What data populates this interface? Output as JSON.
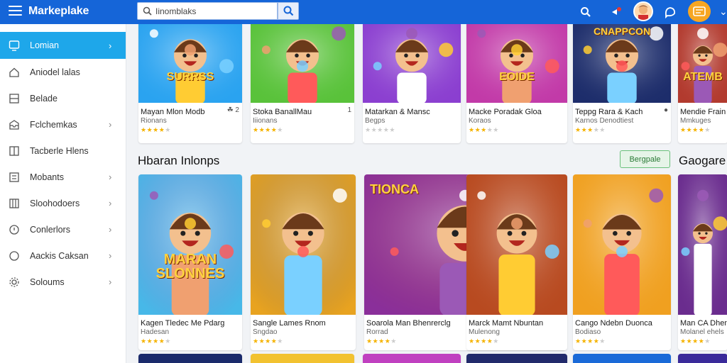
{
  "header": {
    "title": "Markeplake",
    "search": {
      "value": "Iinomblaks",
      "placeholder": "Search"
    },
    "icons": [
      "menu-icon",
      "search-icon",
      "notification-icon",
      "profile-avatar",
      "chat-icon",
      "wallet-icon"
    ]
  },
  "sidebar": {
    "items": [
      {
        "label": "Lomian",
        "icon": "monitor-icon",
        "active": true,
        "arrow": true
      },
      {
        "label": "Aniodel lalas",
        "icon": "home-icon",
        "arrow": false
      },
      {
        "label": "Belade",
        "icon": "grid-icon",
        "arrow": false
      },
      {
        "label": "Fclchemkas",
        "icon": "inbox-icon",
        "arrow": true
      },
      {
        "label": "Tacberle Hlens",
        "icon": "book-icon",
        "arrow": false
      },
      {
        "label": "Mobants",
        "icon": "list-icon",
        "arrow": true
      },
      {
        "label": "Sloohodoers",
        "icon": "columns-icon",
        "arrow": true
      },
      {
        "label": "Conlerlors",
        "icon": "settings-icon",
        "arrow": true
      },
      {
        "label": "Aackis Caksan",
        "icon": "circle-icon",
        "arrow": true
      },
      {
        "label": "Soloums",
        "icon": "gear-icon",
        "arrow": true
      }
    ]
  },
  "row1": [
    {
      "title": "Mayan Mlon Modb",
      "subtitle": "Rionans",
      "meta": "☘ 2",
      "rating": 4,
      "banner": "SURRSS",
      "bg": "#2aa3f0"
    },
    {
      "title": "Stoka BanallMau",
      "subtitle": "Iiionans",
      "meta": "1",
      "rating": 4,
      "banner": "",
      "bg": "#59c23a"
    },
    {
      "title": "Matarkan & Mansc",
      "subtitle": "Begps",
      "meta": "",
      "rating": 0,
      "banner": "",
      "bg": "#8b3fd0"
    },
    {
      "title": "Macke Poradak Gloa",
      "subtitle": "Koraos",
      "meta": "",
      "rating": 3,
      "banner": "EOIDE",
      "bg": "#c23aa8"
    },
    {
      "title": "Teppg Rara & Kach",
      "subtitle": "Karnos Denodtiest",
      "meta": "●",
      "rating": 3,
      "banner": "CNAPPCON",
      "bg": "#1d2d6b"
    },
    {
      "title": "Mendie Frain",
      "subtitle": "Mmkuges",
      "meta": "",
      "rating": 4,
      "banner": "ATEMB",
      "bg": "#b23a2e"
    }
  ],
  "section2": {
    "title": "Hbaran Inlonps",
    "see_all": "Bergpale",
    "next_title": "Gaogare"
  },
  "row2": [
    {
      "title": "Kagen Tledec Me Pdarg",
      "subtitle": "Hadesan",
      "rating": 4,
      "banner": "MARAN SLONNES",
      "bg": "#47b8e8"
    },
    {
      "title": "Sangle Lames Rnom",
      "subtitle": "Sngdao",
      "rating": 4,
      "banner": "",
      "bg": "#e8a320"
    },
    {
      "title": "Soarola Man Bhenrerclg",
      "subtitle": "Rorrad",
      "rating": 4,
      "banner": "TIONCA",
      "bg": "#8a2f9a"
    },
    {
      "title": "Marck Mamt Nbuntan",
      "subtitle": "Mulenong",
      "rating": 4,
      "banner": "",
      "bg": "#b84a20"
    },
    {
      "title": "Cango Ndebn Duonca",
      "subtitle": "Bodiaso",
      "rating": 4,
      "banner": "",
      "bg": "#f0a020"
    },
    {
      "title": "Man CA Dhenr",
      "subtitle": "Molanel ehels",
      "rating": 4,
      "banner": "",
      "bg": "#6a2c8e"
    }
  ],
  "row3_colors": [
    "#1a2a6b",
    "#f2c230",
    "#c040c0",
    "#222a6b",
    "#1a6ad8",
    "#3a2a9a"
  ],
  "colors": {
    "accent": "#1565d8",
    "active": "#1ea7ea",
    "star": "#f5b301"
  }
}
